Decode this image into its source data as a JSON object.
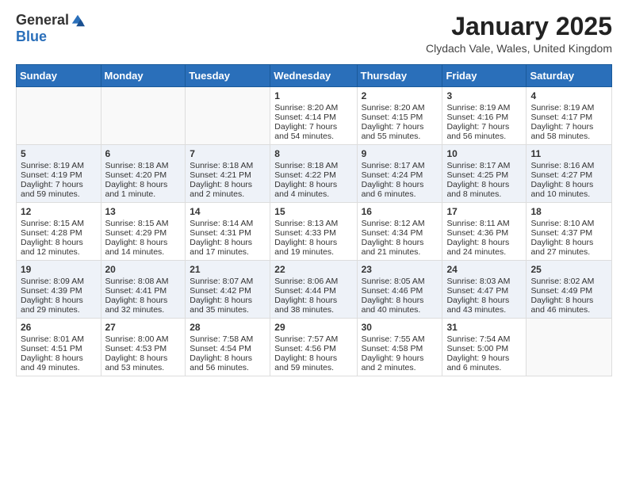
{
  "header": {
    "logo_general": "General",
    "logo_blue": "Blue",
    "month_title": "January 2025",
    "location": "Clydach Vale, Wales, United Kingdom"
  },
  "days_of_week": [
    "Sunday",
    "Monday",
    "Tuesday",
    "Wednesday",
    "Thursday",
    "Friday",
    "Saturday"
  ],
  "weeks": [
    [
      {
        "day": "",
        "data": []
      },
      {
        "day": "",
        "data": []
      },
      {
        "day": "",
        "data": []
      },
      {
        "day": "1",
        "data": [
          "Sunrise: 8:20 AM",
          "Sunset: 4:14 PM",
          "Daylight: 7 hours",
          "and 54 minutes."
        ]
      },
      {
        "day": "2",
        "data": [
          "Sunrise: 8:20 AM",
          "Sunset: 4:15 PM",
          "Daylight: 7 hours",
          "and 55 minutes."
        ]
      },
      {
        "day": "3",
        "data": [
          "Sunrise: 8:19 AM",
          "Sunset: 4:16 PM",
          "Daylight: 7 hours",
          "and 56 minutes."
        ]
      },
      {
        "day": "4",
        "data": [
          "Sunrise: 8:19 AM",
          "Sunset: 4:17 PM",
          "Daylight: 7 hours",
          "and 58 minutes."
        ]
      }
    ],
    [
      {
        "day": "5",
        "data": [
          "Sunrise: 8:19 AM",
          "Sunset: 4:19 PM",
          "Daylight: 7 hours",
          "and 59 minutes."
        ]
      },
      {
        "day": "6",
        "data": [
          "Sunrise: 8:18 AM",
          "Sunset: 4:20 PM",
          "Daylight: 8 hours",
          "and 1 minute."
        ]
      },
      {
        "day": "7",
        "data": [
          "Sunrise: 8:18 AM",
          "Sunset: 4:21 PM",
          "Daylight: 8 hours",
          "and 2 minutes."
        ]
      },
      {
        "day": "8",
        "data": [
          "Sunrise: 8:18 AM",
          "Sunset: 4:22 PM",
          "Daylight: 8 hours",
          "and 4 minutes."
        ]
      },
      {
        "day": "9",
        "data": [
          "Sunrise: 8:17 AM",
          "Sunset: 4:24 PM",
          "Daylight: 8 hours",
          "and 6 minutes."
        ]
      },
      {
        "day": "10",
        "data": [
          "Sunrise: 8:17 AM",
          "Sunset: 4:25 PM",
          "Daylight: 8 hours",
          "and 8 minutes."
        ]
      },
      {
        "day": "11",
        "data": [
          "Sunrise: 8:16 AM",
          "Sunset: 4:27 PM",
          "Daylight: 8 hours",
          "and 10 minutes."
        ]
      }
    ],
    [
      {
        "day": "12",
        "data": [
          "Sunrise: 8:15 AM",
          "Sunset: 4:28 PM",
          "Daylight: 8 hours",
          "and 12 minutes."
        ]
      },
      {
        "day": "13",
        "data": [
          "Sunrise: 8:15 AM",
          "Sunset: 4:29 PM",
          "Daylight: 8 hours",
          "and 14 minutes."
        ]
      },
      {
        "day": "14",
        "data": [
          "Sunrise: 8:14 AM",
          "Sunset: 4:31 PM",
          "Daylight: 8 hours",
          "and 17 minutes."
        ]
      },
      {
        "day": "15",
        "data": [
          "Sunrise: 8:13 AM",
          "Sunset: 4:33 PM",
          "Daylight: 8 hours",
          "and 19 minutes."
        ]
      },
      {
        "day": "16",
        "data": [
          "Sunrise: 8:12 AM",
          "Sunset: 4:34 PM",
          "Daylight: 8 hours",
          "and 21 minutes."
        ]
      },
      {
        "day": "17",
        "data": [
          "Sunrise: 8:11 AM",
          "Sunset: 4:36 PM",
          "Daylight: 8 hours",
          "and 24 minutes."
        ]
      },
      {
        "day": "18",
        "data": [
          "Sunrise: 8:10 AM",
          "Sunset: 4:37 PM",
          "Daylight: 8 hours",
          "and 27 minutes."
        ]
      }
    ],
    [
      {
        "day": "19",
        "data": [
          "Sunrise: 8:09 AM",
          "Sunset: 4:39 PM",
          "Daylight: 8 hours",
          "and 29 minutes."
        ]
      },
      {
        "day": "20",
        "data": [
          "Sunrise: 8:08 AM",
          "Sunset: 4:41 PM",
          "Daylight: 8 hours",
          "and 32 minutes."
        ]
      },
      {
        "day": "21",
        "data": [
          "Sunrise: 8:07 AM",
          "Sunset: 4:42 PM",
          "Daylight: 8 hours",
          "and 35 minutes."
        ]
      },
      {
        "day": "22",
        "data": [
          "Sunrise: 8:06 AM",
          "Sunset: 4:44 PM",
          "Daylight: 8 hours",
          "and 38 minutes."
        ]
      },
      {
        "day": "23",
        "data": [
          "Sunrise: 8:05 AM",
          "Sunset: 4:46 PM",
          "Daylight: 8 hours",
          "and 40 minutes."
        ]
      },
      {
        "day": "24",
        "data": [
          "Sunrise: 8:03 AM",
          "Sunset: 4:47 PM",
          "Daylight: 8 hours",
          "and 43 minutes."
        ]
      },
      {
        "day": "25",
        "data": [
          "Sunrise: 8:02 AM",
          "Sunset: 4:49 PM",
          "Daylight: 8 hours",
          "and 46 minutes."
        ]
      }
    ],
    [
      {
        "day": "26",
        "data": [
          "Sunrise: 8:01 AM",
          "Sunset: 4:51 PM",
          "Daylight: 8 hours",
          "and 49 minutes."
        ]
      },
      {
        "day": "27",
        "data": [
          "Sunrise: 8:00 AM",
          "Sunset: 4:53 PM",
          "Daylight: 8 hours",
          "and 53 minutes."
        ]
      },
      {
        "day": "28",
        "data": [
          "Sunrise: 7:58 AM",
          "Sunset: 4:54 PM",
          "Daylight: 8 hours",
          "and 56 minutes."
        ]
      },
      {
        "day": "29",
        "data": [
          "Sunrise: 7:57 AM",
          "Sunset: 4:56 PM",
          "Daylight: 8 hours",
          "and 59 minutes."
        ]
      },
      {
        "day": "30",
        "data": [
          "Sunrise: 7:55 AM",
          "Sunset: 4:58 PM",
          "Daylight: 9 hours",
          "and 2 minutes."
        ]
      },
      {
        "day": "31",
        "data": [
          "Sunrise: 7:54 AM",
          "Sunset: 5:00 PM",
          "Daylight: 9 hours",
          "and 6 minutes."
        ]
      },
      {
        "day": "",
        "data": []
      }
    ]
  ]
}
